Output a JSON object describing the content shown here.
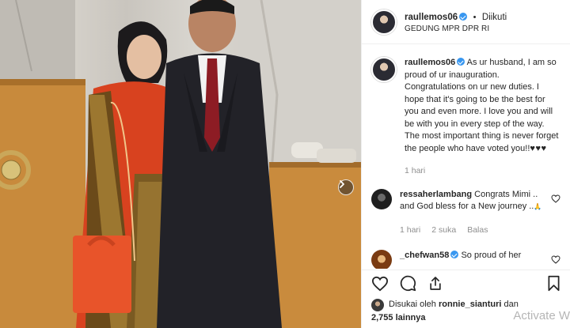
{
  "post": {
    "username": "raullemos06",
    "separator": "•",
    "follow_status": "Diikuti",
    "location": "GEDUNG MPR DPR RI"
  },
  "caption": {
    "username": "raullemos06",
    "text": "As ur husband, I am so proud of ur inauguration. Congratulations on ur new duties. I hope that it's going to be the best for you and even more. I love you and will be with you in every step of the way. The most important thing is never forget the people who have voted you!!",
    "hearts": "♥♥♥",
    "time": "1 hari"
  },
  "comments": [
    {
      "username": "ressaherlambang",
      "text": "Congrats Mimi .. and God bless for a New journey ..",
      "emoji": "🙏",
      "time": "1 hari",
      "likes": "2 suka",
      "reply": "Balas"
    },
    {
      "username": "_chefwan58",
      "text": "So proud of her"
    }
  ],
  "likes": {
    "prefix": "Disukai oleh",
    "user": "ronnie_sianturi",
    "conjunction": "dan",
    "others": "2,755 lainnya"
  },
  "overlay": {
    "watermark": "Activate W"
  },
  "icons": {
    "like": "heart-icon",
    "comment": "comment-icon",
    "share": "share-icon",
    "save": "bookmark-icon",
    "next": "chevron-right-icon"
  }
}
